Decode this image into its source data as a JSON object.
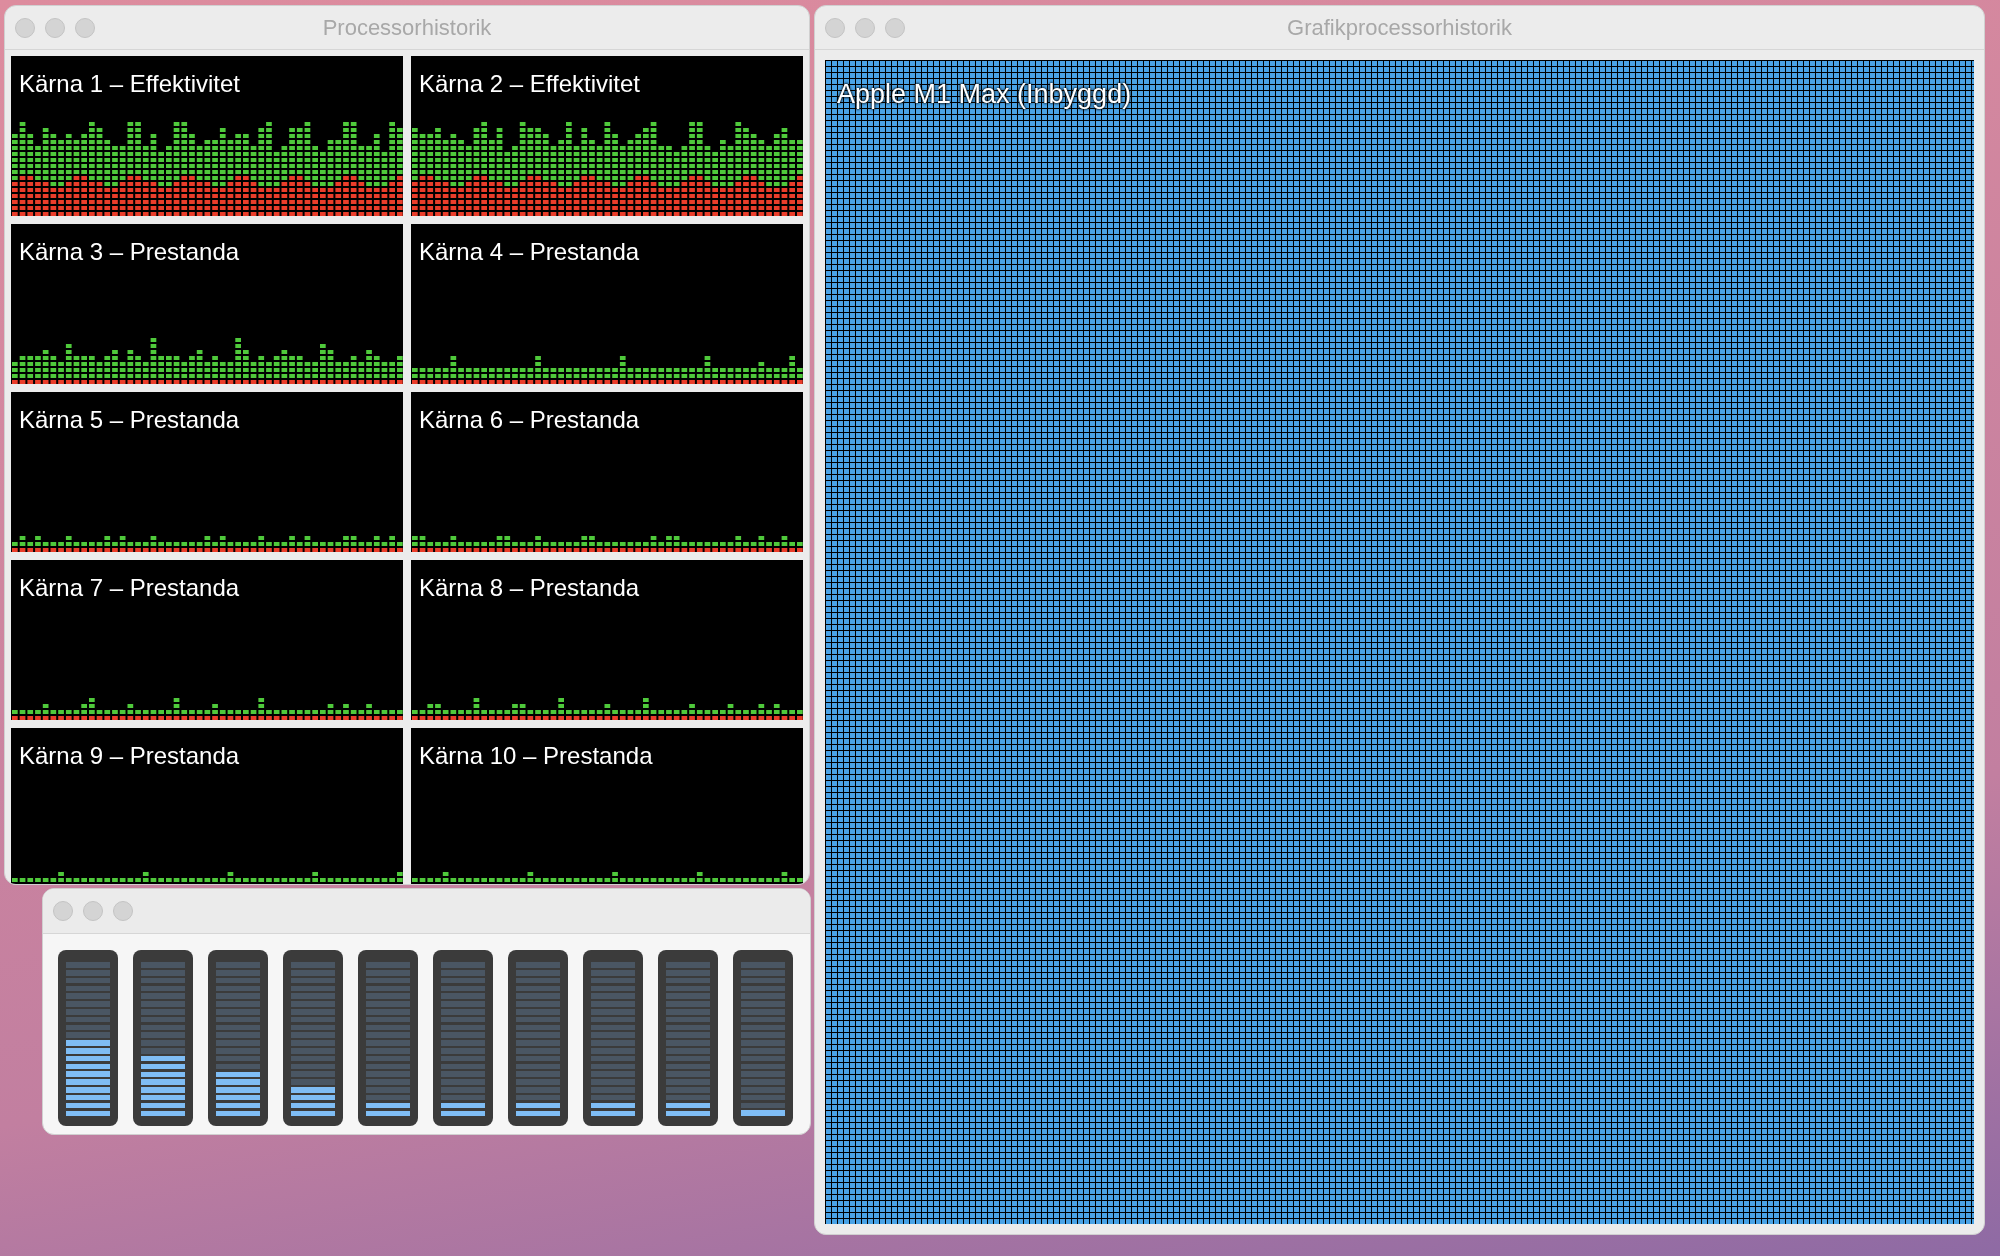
{
  "cpu_window": {
    "title": "Processorhistorik",
    "cores": [
      {
        "label": "Kärna 1 – Effektivitet"
      },
      {
        "label": "Kärna 2 – Effektivitet"
      },
      {
        "label": "Kärna 3 – Prestanda"
      },
      {
        "label": "Kärna 4 – Prestanda"
      },
      {
        "label": "Kärna 5 – Prestanda"
      },
      {
        "label": "Kärna 6 – Prestanda"
      },
      {
        "label": "Kärna 7 – Prestanda"
      },
      {
        "label": "Kärna 8 – Prestanda"
      },
      {
        "label": "Kärna 9 – Prestanda"
      },
      {
        "label": "Kärna 10 – Prestanda"
      }
    ]
  },
  "meter_window": {
    "meters": [
      {
        "level": 0.5
      },
      {
        "level": 0.4
      },
      {
        "level": 0.3
      },
      {
        "level": 0.2
      },
      {
        "level": 0.1
      },
      {
        "level": 0.1
      },
      {
        "level": 0.1
      },
      {
        "level": 0.1
      },
      {
        "level": 0.1
      },
      {
        "level": 0.05
      }
    ]
  },
  "gpu_window": {
    "title": "Grafikprocessorhistorik",
    "gpus": [
      {
        "label": "Apple M1 Max (Inbyggd)"
      }
    ]
  }
}
